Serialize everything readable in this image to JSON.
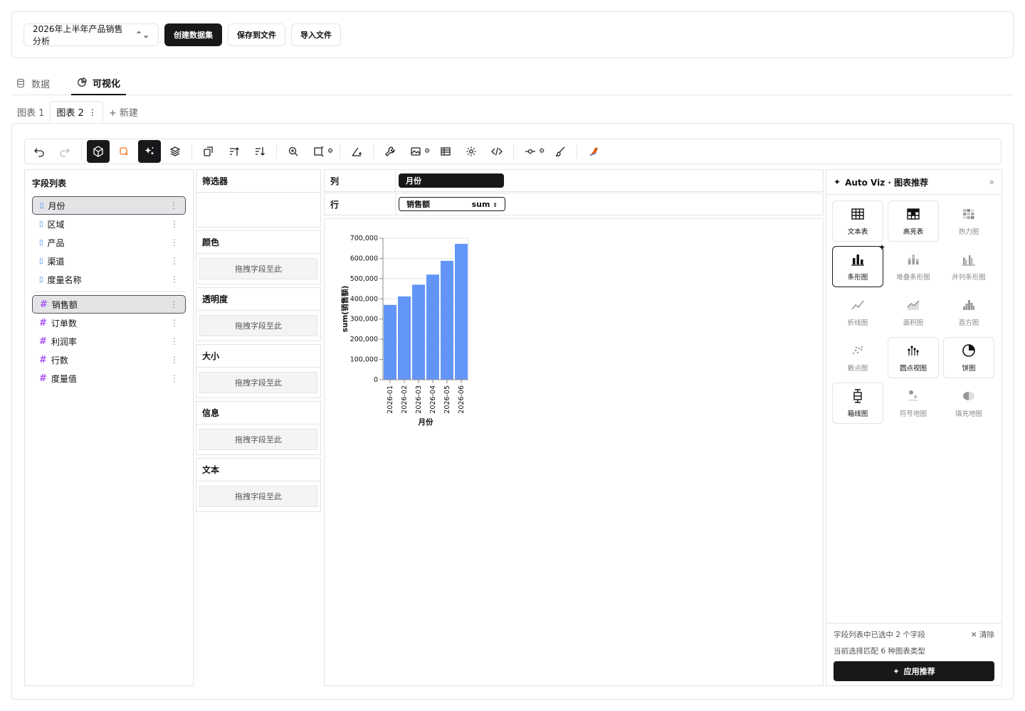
{
  "topbar": {
    "dataset_name": "2026年上半年产品销售分析",
    "create_dataset": "创建数据集",
    "save_file": "保存到文件",
    "import_file": "导入文件"
  },
  "tabs": {
    "data": "数据",
    "visualize": "可视化"
  },
  "chart_tabs": {
    "chart1": "图表 1",
    "chart2": "图表 2",
    "new": "+ 新建"
  },
  "field_list": {
    "title": "字段列表",
    "dimensions": [
      "月份",
      "区域",
      "产品",
      "渠道",
      "度量名称"
    ],
    "measures": [
      "销售额",
      "订单数",
      "利润率",
      "行数",
      "度量值"
    ]
  },
  "encodings": {
    "filter": "筛选器",
    "drop_hint": "拖拽字段至此",
    "channels": [
      "颜色",
      "透明度",
      "大小",
      "信息",
      "文本"
    ]
  },
  "shelves": {
    "columns_label": "列",
    "columns_field": "月份",
    "rows_label": "行",
    "rows_field": "销售额",
    "rows_agg": "sum"
  },
  "chart_data": {
    "type": "bar",
    "categories": [
      "2026-01",
      "2026-02",
      "2026-03",
      "2026-04",
      "2026-05",
      "2026-06"
    ],
    "values": [
      370000,
      412000,
      470000,
      520000,
      588000,
      672000
    ],
    "xlabel": "月份",
    "ylabel": "sum(销售额)",
    "ylim": [
      0,
      700000
    ],
    "yticks": [
      "0",
      "100,000",
      "200,000",
      "300,000",
      "400,000",
      "500,000",
      "600,000",
      "700,000"
    ],
    "color": "#6395F9"
  },
  "autoviz": {
    "title": "Auto Viz · 图表推荐",
    "charts": [
      {
        "label": "文本表",
        "icon": "table-icon",
        "state": "match"
      },
      {
        "label": "高亮表",
        "icon": "highlight-table-icon",
        "state": "match"
      },
      {
        "label": "热力图",
        "icon": "heatmap-icon",
        "state": "none"
      },
      {
        "label": "条形图",
        "icon": "bar-chart-icon",
        "state": "chosen"
      },
      {
        "label": "堆叠条形图",
        "icon": "stacked-bar-icon",
        "state": "none"
      },
      {
        "label": "并列条形图",
        "icon": "grouped-bar-icon",
        "state": "none"
      },
      {
        "label": "折线图",
        "icon": "line-chart-icon",
        "state": "none"
      },
      {
        "label": "面积图",
        "icon": "area-chart-icon",
        "state": "none"
      },
      {
        "label": "直方图",
        "icon": "histogram-icon",
        "state": "none"
      },
      {
        "label": "散点图",
        "icon": "scatter-icon",
        "state": "none"
      },
      {
        "label": "圆点视图",
        "icon": "dot-plot-icon",
        "state": "match"
      },
      {
        "label": "饼图",
        "icon": "pie-chart-icon",
        "state": "match"
      },
      {
        "label": "箱线图",
        "icon": "boxplot-icon",
        "state": "match"
      },
      {
        "label": "符号地图",
        "icon": "symbol-map-icon",
        "state": "none"
      },
      {
        "label": "填充地图",
        "icon": "filled-map-icon",
        "state": "none"
      }
    ],
    "selected_info": "字段列表中已选中 2 个字段",
    "clear": "清除",
    "match_info": "当前选择匹配 6 种图表类型",
    "apply": "应用推荐"
  }
}
